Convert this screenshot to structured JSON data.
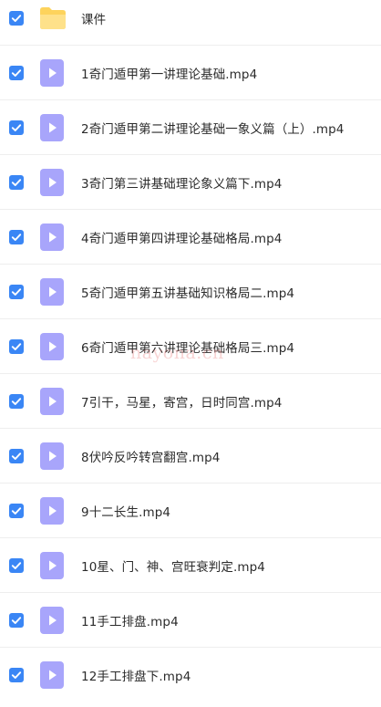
{
  "files": [
    {
      "name": "课件",
      "kind": "folder",
      "checked": true
    },
    {
      "name": "1奇门遁甲第一讲理论基础.mp4",
      "kind": "video",
      "checked": true
    },
    {
      "name": "2奇门遁甲第二讲理论基础一象义篇（上）.mp4",
      "kind": "video",
      "checked": true
    },
    {
      "name": "3奇门第三讲基础理论象义篇下.mp4",
      "kind": "video",
      "checked": true
    },
    {
      "name": "4奇门遁甲第四讲理论基础格局.mp4",
      "kind": "video",
      "checked": true
    },
    {
      "name": "5奇门遁甲第五讲基础知识格局二.mp4",
      "kind": "video",
      "checked": true
    },
    {
      "name": "6奇门遁甲第六讲理论基础格局三.mp4",
      "kind": "video",
      "checked": true
    },
    {
      "name": "7引干，马星，寄宫，日时同宫.mp4",
      "kind": "video",
      "checked": true
    },
    {
      "name": "8伏吟反吟转宫翻宫.mp4",
      "kind": "video",
      "checked": true
    },
    {
      "name": "9十二长生.mp4",
      "kind": "video",
      "checked": true
    },
    {
      "name": "10星、门、神、宫旺衰判定.mp4",
      "kind": "video",
      "checked": true
    },
    {
      "name": "11手工排盘.mp4",
      "kind": "video",
      "checked": true
    },
    {
      "name": "12手工排盘下.mp4",
      "kind": "video",
      "checked": true
    }
  ],
  "watermark": "nayona.cn",
  "colors": {
    "checkbox": "#3a86f5",
    "video_icon": "#a8a5fb",
    "folder_icon": "#fdd35c",
    "divider": "#eeeeee"
  },
  "icons": {
    "checkbox": "checkmark-icon",
    "folder": "folder-icon",
    "video": "video-file-icon"
  }
}
